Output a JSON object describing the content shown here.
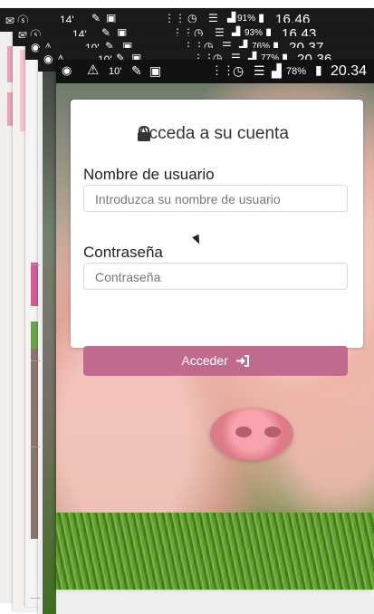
{
  "colors": {
    "status_bar": "#111111",
    "card_background": "#ffffff",
    "button_background": "#c06a8e",
    "title_text": "#333333",
    "placeholder_text": "#777777",
    "pink_accent": "#e8a2b8",
    "green_accent": "#6ca24b"
  },
  "status_bar": {
    "battery_percent": "78%",
    "time": "20.34",
    "left_small_text": "10'",
    "icons": {
      "stopwatch_icon": "stopwatch-icon",
      "warning_icon": "warning-icon",
      "pen_icon": "pen-icon",
      "clipboard_icon": "clipboard-icon",
      "vibration_icon": "vibration-icon",
      "alarm_icon": "alarm-icon",
      "wifi_icon": "wifi-icon",
      "signal_icon": "signal-icon",
      "battery_icon": "battery-icon"
    }
  },
  "stacked_screenshots": [
    {
      "battery_percent": "91%",
      "time": "16.46",
      "left_small_text": "14'"
    },
    {
      "battery_percent": "93%",
      "time": "16.43",
      "left_small_text": "14'"
    },
    {
      "battery_percent": "76%",
      "time": "20.37",
      "left_small_text": "10'"
    },
    {
      "battery_percent": "77%",
      "time": "20.36",
      "left_small_text": "10'"
    }
  ],
  "login": {
    "title": "Acceda a su cuenta",
    "username": {
      "label": "Nombre de usuario",
      "placeholder": "Introduzca su nombre de usuario"
    },
    "password": {
      "label": "Contraseña",
      "placeholder": "Contraseña"
    },
    "button": {
      "label": "Acceder",
      "icon": "login-icon"
    },
    "title_icon": "lock-icon"
  }
}
